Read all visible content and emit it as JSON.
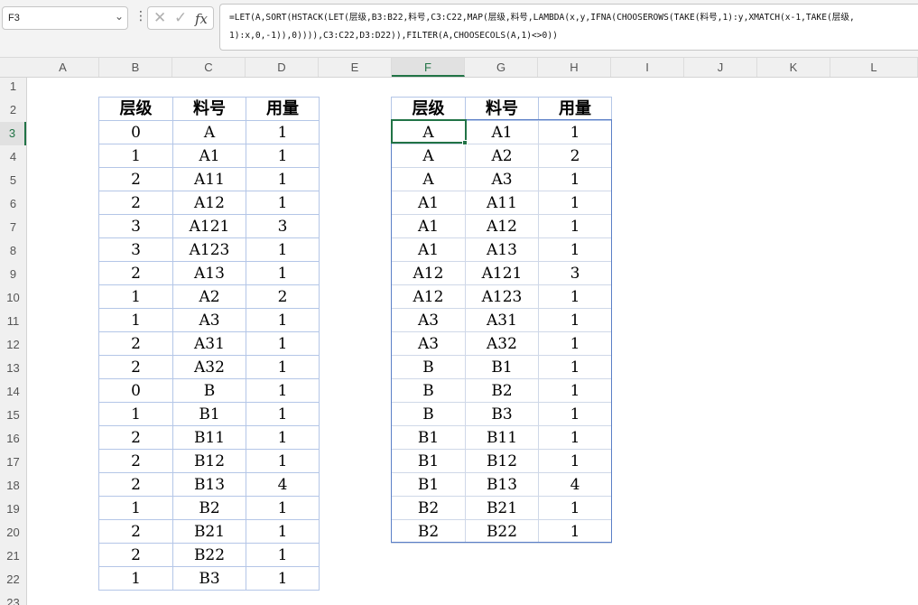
{
  "formula_bar": {
    "name_box": "F3",
    "name_box_dropdown_icon": "chevron-down-icon",
    "more_icon": "vertical-ellipsis-icon",
    "cancel_icon": "close-icon",
    "enter_icon": "checkmark-icon",
    "fx_label": "fx",
    "formula": "=LET(A,SORT(HSTACK(LET(层级,B3:B22,料号,C3:C22,MAP(层级,料号,LAMBDA(x,y,IFNA(CHOOSEROWS(TAKE(料号,1):y,XMATCH(x-1,TAKE(层级,\n1):x,0,-1)),0)))),C3:C22,D3:D22)),FILTER(A,CHOOSECOLS(A,1)<>0))"
  },
  "columns": [
    "A",
    "B",
    "C",
    "D",
    "E",
    "F",
    "G",
    "H",
    "I",
    "J",
    "K",
    "L"
  ],
  "selected_column": "F",
  "rows": [
    "1",
    "2",
    "3",
    "4",
    "5",
    "6",
    "7",
    "8",
    "9",
    "10",
    "11",
    "12",
    "13",
    "14",
    "15",
    "16",
    "17",
    "18",
    "19",
    "20",
    "21",
    "22",
    "23"
  ],
  "selected_row": "3",
  "source_table": {
    "headers": [
      "层级",
      "料号",
      "用量"
    ],
    "rows": [
      [
        "0",
        "A",
        "1"
      ],
      [
        "1",
        "A1",
        "1"
      ],
      [
        "2",
        "A11",
        "1"
      ],
      [
        "2",
        "A12",
        "1"
      ],
      [
        "3",
        "A121",
        "3"
      ],
      [
        "3",
        "A123",
        "1"
      ],
      [
        "2",
        "A13",
        "1"
      ],
      [
        "1",
        "A2",
        "2"
      ],
      [
        "1",
        "A3",
        "1"
      ],
      [
        "2",
        "A31",
        "1"
      ],
      [
        "2",
        "A32",
        "1"
      ],
      [
        "0",
        "B",
        "1"
      ],
      [
        "1",
        "B1",
        "1"
      ],
      [
        "2",
        "B11",
        "1"
      ],
      [
        "2",
        "B12",
        "1"
      ],
      [
        "2",
        "B13",
        "4"
      ],
      [
        "1",
        "B2",
        "1"
      ],
      [
        "2",
        "B21",
        "1"
      ],
      [
        "2",
        "B22",
        "1"
      ],
      [
        "1",
        "B3",
        "1"
      ]
    ]
  },
  "result_table": {
    "headers": [
      "层级",
      "料号",
      "用量"
    ],
    "rows": [
      [
        "A",
        "A1",
        "1"
      ],
      [
        "A",
        "A2",
        "2"
      ],
      [
        "A",
        "A3",
        "1"
      ],
      [
        "A1",
        "A11",
        "1"
      ],
      [
        "A1",
        "A12",
        "1"
      ],
      [
        "A1",
        "A13",
        "1"
      ],
      [
        "A12",
        "A121",
        "3"
      ],
      [
        "A12",
        "A123",
        "1"
      ],
      [
        "A3",
        "A31",
        "1"
      ],
      [
        "A3",
        "A32",
        "1"
      ],
      [
        "B",
        "B1",
        "1"
      ],
      [
        "B",
        "B2",
        "1"
      ],
      [
        "B",
        "B3",
        "1"
      ],
      [
        "B1",
        "B11",
        "1"
      ],
      [
        "B1",
        "B12",
        "1"
      ],
      [
        "B1",
        "B13",
        "4"
      ],
      [
        "B2",
        "B21",
        "1"
      ],
      [
        "B2",
        "B22",
        "1"
      ]
    ]
  },
  "colors": {
    "accent_green": "#217346",
    "table_border": "#b4c6e7",
    "result_outline": "#5b7fc7"
  }
}
